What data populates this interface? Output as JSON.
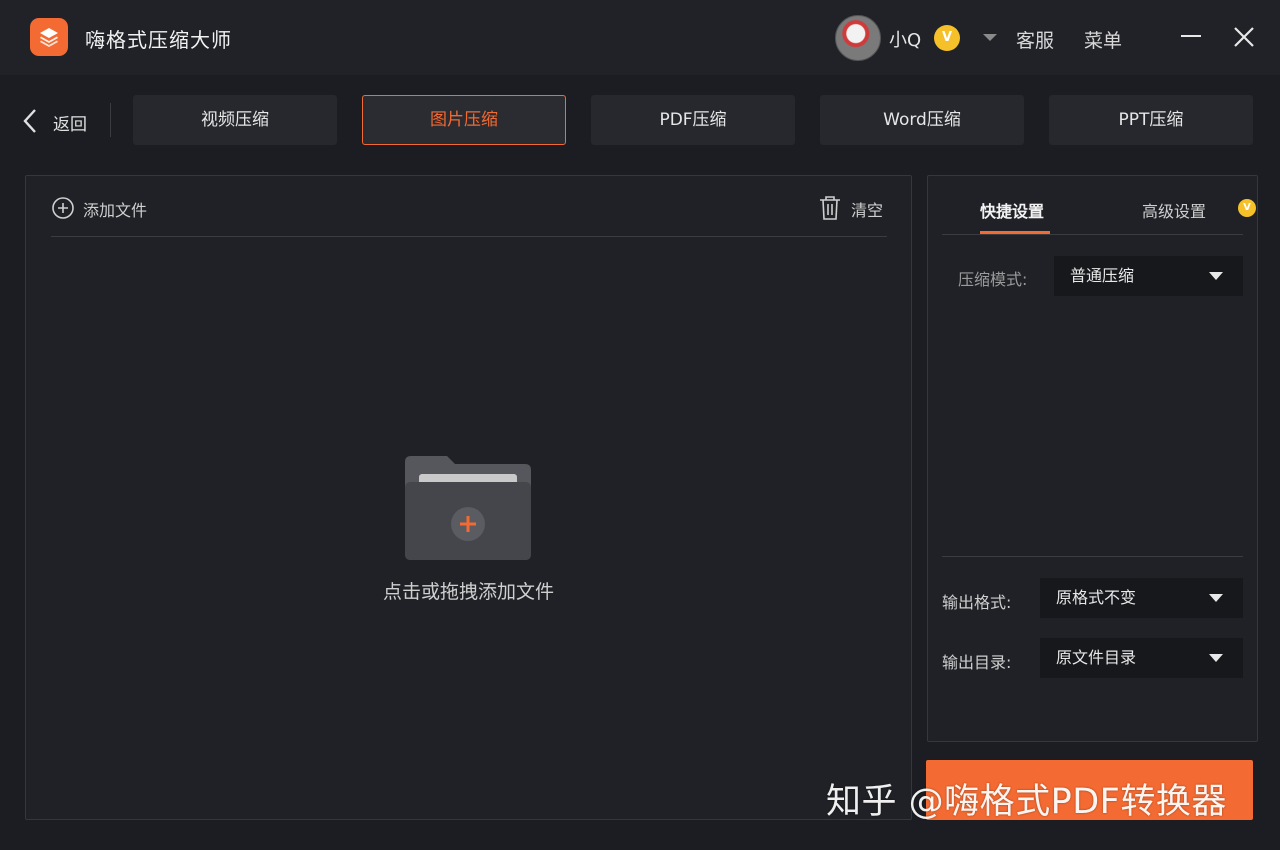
{
  "app": {
    "title": "嗨格式压缩大师",
    "logo_icon": "layers-icon",
    "accent_color": "#f36a32"
  },
  "user": {
    "name": "小Q",
    "vip_badge": "V"
  },
  "header": {
    "service_label": "客服",
    "menu_label": "菜单"
  },
  "nav": {
    "back_label": "返回",
    "tabs": [
      {
        "label": "视频压缩",
        "active": false
      },
      {
        "label": "图片压缩",
        "active": true
      },
      {
        "label": "PDF压缩",
        "active": false
      },
      {
        "label": "Word压缩",
        "active": false
      },
      {
        "label": "PPT压缩",
        "active": false
      }
    ]
  },
  "file_area": {
    "add_file_label": "添加文件",
    "clear_label": "清空",
    "drop_hint": "点击或拖拽添加文件"
  },
  "settings": {
    "tabs": {
      "quick": "快捷设置",
      "advanced": "高级设置"
    },
    "advanced_vip_badge": "V",
    "compress_mode": {
      "label": "压缩模式:",
      "value": "普通压缩"
    },
    "output_format": {
      "label": "输出格式:",
      "value": "原格式不变"
    },
    "output_dir": {
      "label": "输出目录:",
      "value": "原文件目录"
    }
  },
  "watermark": "知乎 @嗨格式PDF转换器"
}
